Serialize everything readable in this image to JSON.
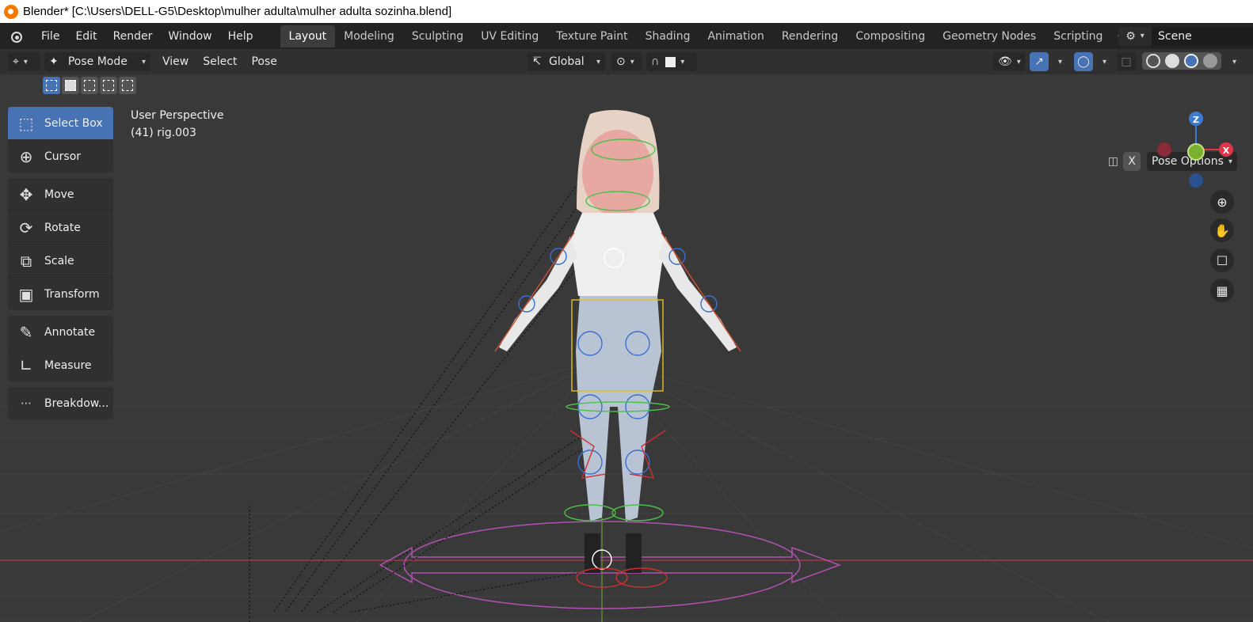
{
  "window": {
    "title": "Blender* [C:\\Users\\DELL-G5\\Desktop\\mulher adulta\\mulher adulta sozinha.blend]"
  },
  "menu": [
    "File",
    "Edit",
    "Render",
    "Window",
    "Help"
  ],
  "workspaces": [
    {
      "label": "Layout",
      "active": true
    },
    {
      "label": "Modeling"
    },
    {
      "label": "Sculpting"
    },
    {
      "label": "UV Editing"
    },
    {
      "label": "Texture Paint"
    },
    {
      "label": "Shading"
    },
    {
      "label": "Animation"
    },
    {
      "label": "Rendering"
    },
    {
      "label": "Compositing"
    },
    {
      "label": "Geometry Nodes"
    },
    {
      "label": "Scripting"
    }
  ],
  "scene": {
    "name": "Scene"
  },
  "header": {
    "mode": "Pose Mode",
    "view": "View",
    "select": "Select",
    "pose": "Pose",
    "orientation": "Global",
    "pose_options": "Pose Options",
    "x_label": "X"
  },
  "tools": [
    {
      "label": "Select Box",
      "icon": "select-box-icon",
      "active": true
    },
    {
      "label": "Cursor",
      "icon": "cursor-icon"
    },
    {
      "label": "Move",
      "icon": "move-icon"
    },
    {
      "label": "Rotate",
      "icon": "rotate-icon"
    },
    {
      "label": "Scale",
      "icon": "scale-icon"
    },
    {
      "label": "Transform",
      "icon": "transform-icon"
    },
    {
      "label": "Annotate",
      "icon": "annotate-icon"
    },
    {
      "label": "Measure",
      "icon": "measure-icon"
    },
    {
      "label": "Breakdow...",
      "icon": "breakdown-icon"
    }
  ],
  "viewport": {
    "perspective": "User Perspective",
    "object": "(41) rig.003"
  },
  "gizmo": {
    "z": "Z",
    "x": "X"
  },
  "colors": {
    "accent": "#4772b3",
    "x_axis": "#e0364a",
    "y_axis": "#7ab030",
    "z_axis": "#3d7bd1"
  }
}
